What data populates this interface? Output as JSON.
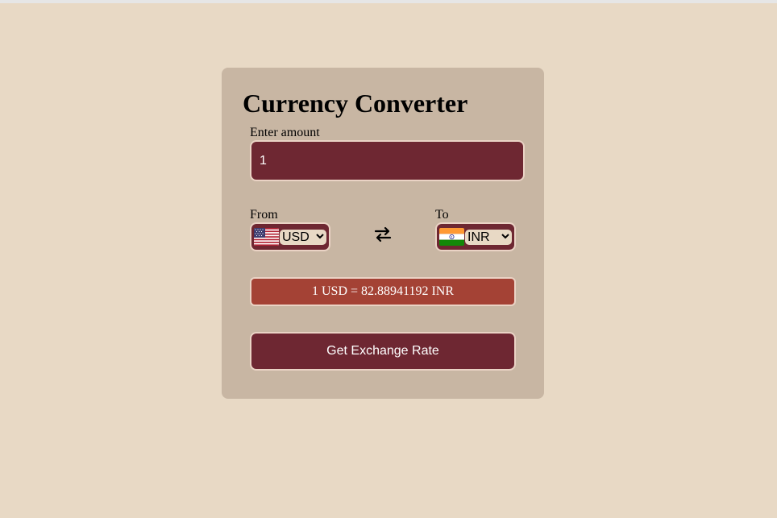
{
  "app": {
    "title": "Currency Converter"
  },
  "amount": {
    "label": "Enter amount",
    "value": "1"
  },
  "from": {
    "label": "From",
    "currency": "USD",
    "flag_icon": "us-flag-icon"
  },
  "to": {
    "label": "To",
    "currency": "INR",
    "flag_icon": "india-flag-icon"
  },
  "swap": {
    "icon": "swap-arrows-icon"
  },
  "result": {
    "text": "1 USD = 82.88941192 INR"
  },
  "button": {
    "label": "Get Exchange Rate"
  },
  "colors": {
    "page_background": "#e8d9c5",
    "card_background": "#c8b6a3",
    "primary": "#6e2732",
    "result_background": "#a44235",
    "border": "#ead3c5"
  }
}
